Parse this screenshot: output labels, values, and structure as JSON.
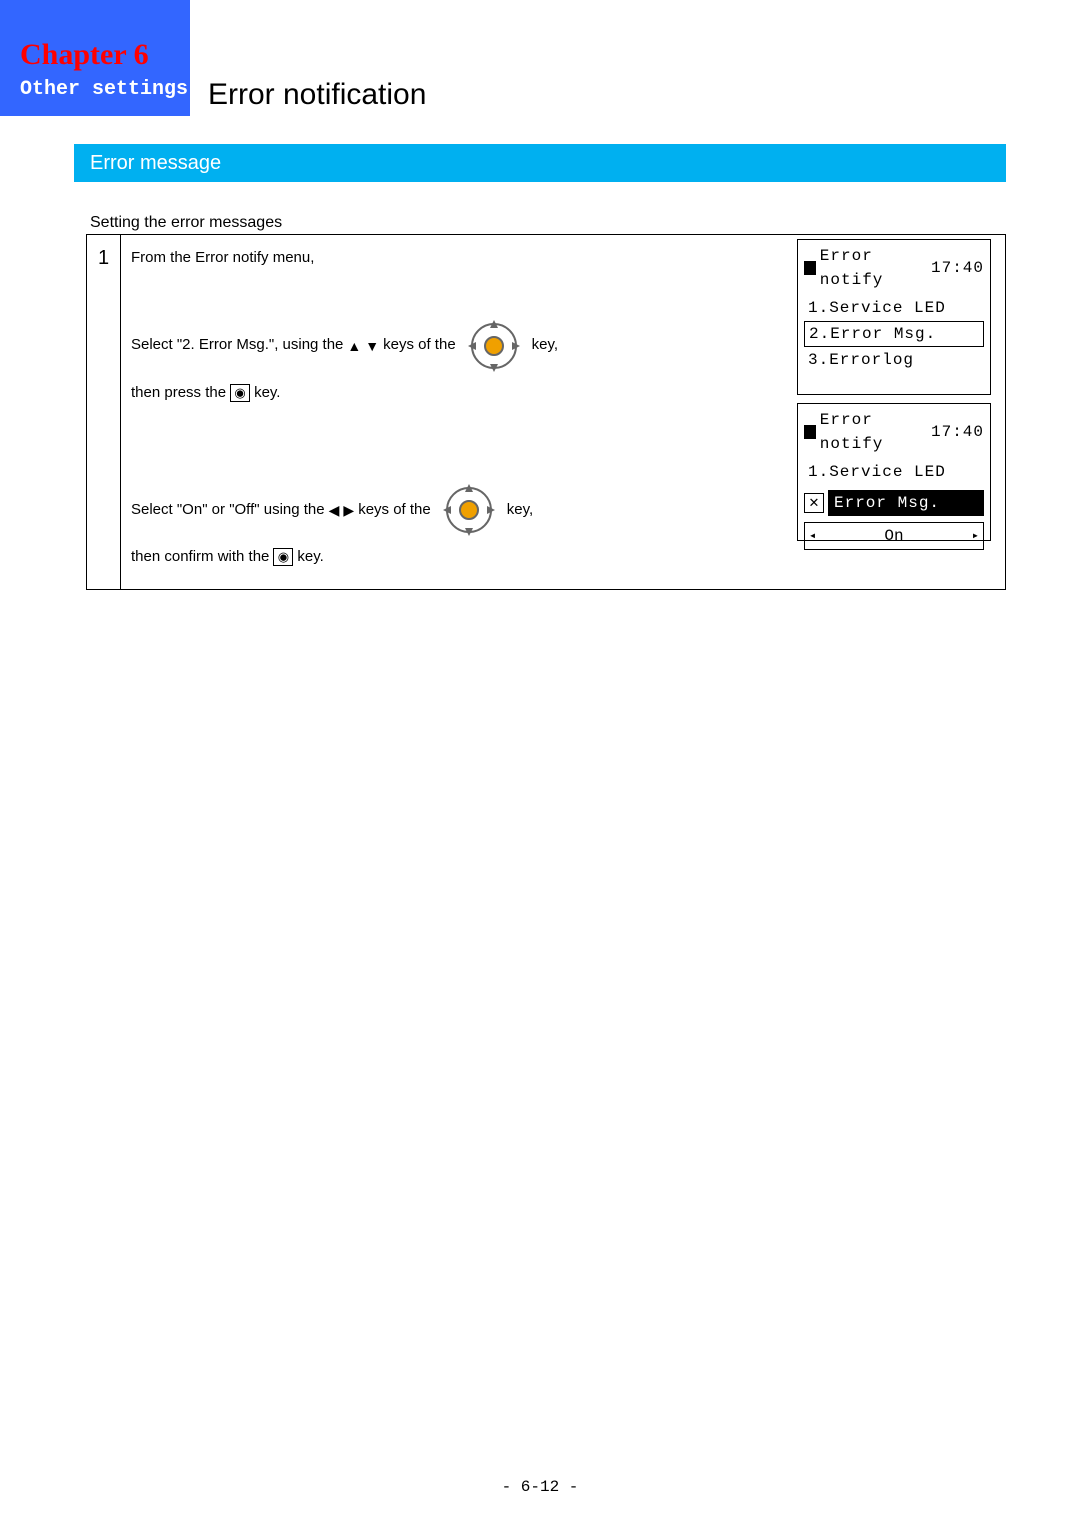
{
  "header": {
    "chapter_label": "Chapter",
    "chapter_number": "6",
    "subtitle": "Other settings"
  },
  "page_title": "Error notification",
  "section_title": "Error message",
  "subheading": "Setting the error messages",
  "step1": {
    "number": "1",
    "line1": "From the Error notify menu,",
    "line2a": "Select \"2. Error Msg.\", using the",
    "line2b": "keys of the",
    "line2c": "key,",
    "line3a": "then press the",
    "line3b": "key.",
    "line4a": "Select \"On\" or \"Off\" using the",
    "line4b": "keys of the",
    "line4c": "key,",
    "line5a": "then confirm with the",
    "line5b": "key."
  },
  "lcd1": {
    "title": "Error notify",
    "time": "17:40",
    "items": [
      "1.Service LED",
      "2.Error Msg.",
      "3.Errorlog"
    ]
  },
  "lcd2": {
    "title": "Error notify",
    "time": "17:40",
    "line1": "1.Service LED",
    "selected": "Error Msg.",
    "value": "On"
  },
  "page_number": "- 6-12 -"
}
